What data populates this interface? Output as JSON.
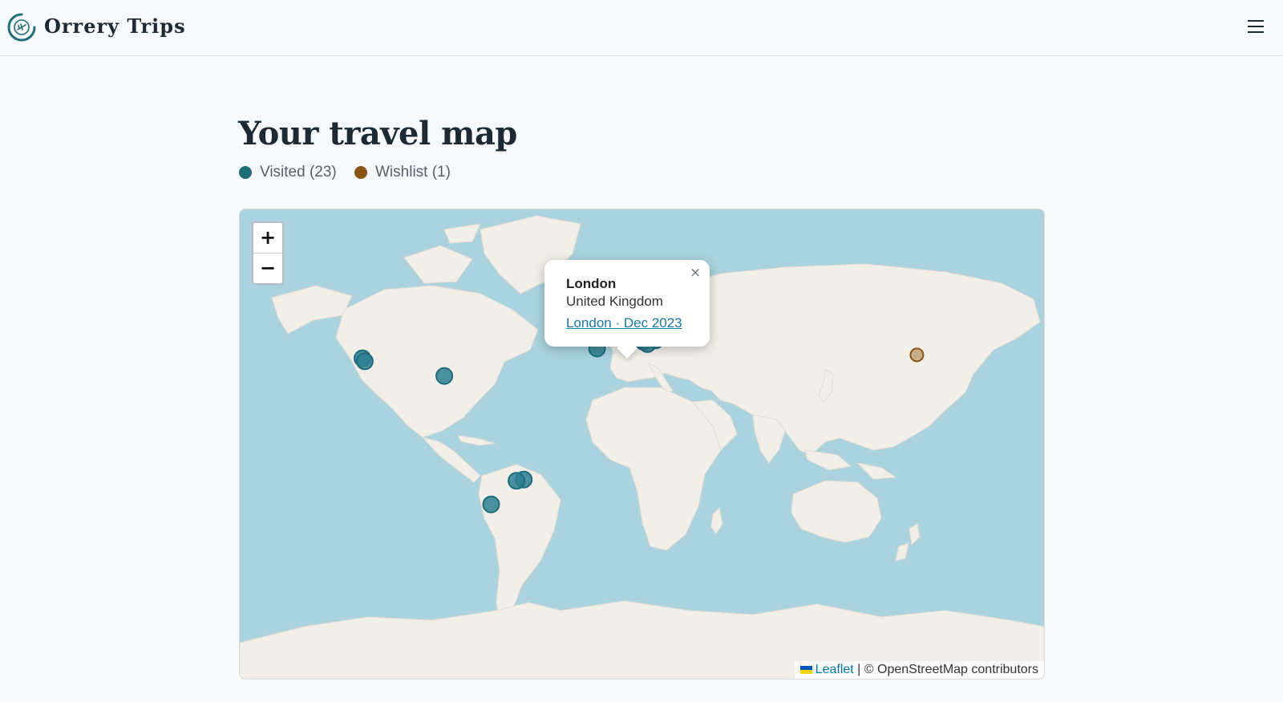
{
  "header": {
    "brand": "Orrery Trips",
    "logo_icon": "compass-plane-icon",
    "menu_icon": "hamburger-menu-icon",
    "accent_color": "#1e6e79"
  },
  "page": {
    "title": "Your travel map"
  },
  "legend": {
    "visited_label": "Visited (23)",
    "visited_color": "#1e6e79",
    "wishlist_label": "Wishlist (1)",
    "wishlist_color": "#8a5415"
  },
  "map": {
    "ocean_color": "#aad3df",
    "land_color": "#f2efe9",
    "marker_color": "#2d7f91",
    "zoom": {
      "in_label": "+",
      "out_label": "−"
    },
    "markers_visited": [
      {
        "lat": 34.1,
        "lon": -118.3
      },
      {
        "lat": 32.7,
        "lon": -117.2
      },
      {
        "lat": 25.8,
        "lon": -80.2
      },
      {
        "lat": 38.7,
        "lon": -9.1
      },
      {
        "lat": 53.3,
        "lon": -6.3
      },
      {
        "lat": 51.5,
        "lon": -0.1
      },
      {
        "lat": 59.3,
        "lon": 18.1
      },
      {
        "lat": 52.5,
        "lon": 13.4
      },
      {
        "lat": 50.1,
        "lon": 14.4
      },
      {
        "lat": 48.2,
        "lon": 16.4
      },
      {
        "lat": 47.5,
        "lon": 19.0
      },
      {
        "lat": 45.5,
        "lon": 12.3
      },
      {
        "lat": 43.8,
        "lon": 11.3
      },
      {
        "lat": 41.9,
        "lon": 12.5
      },
      {
        "lat": 45.8,
        "lon": 16.0
      },
      {
        "lat": 46.0,
        "lon": 14.5
      },
      {
        "lat": 42.6,
        "lon": 18.1
      },
      {
        "lat": 40.8,
        "lon": 14.3
      },
      {
        "lat": 44.8,
        "lon": 20.5
      },
      {
        "lat": 48.9,
        "lon": 2.3
      },
      {
        "lat": -22.9,
        "lon": -43.2
      },
      {
        "lat": -23.5,
        "lon": -46.6
      },
      {
        "lat": -34.6,
        "lon": -58.4
      }
    ],
    "markers_wishlist": [
      {
        "lat": 35.7,
        "lon": 139.7
      }
    ],
    "popup": {
      "title": "London",
      "country": "United Kingdom",
      "link": "London · Dec 2023",
      "close_glyph": "×"
    },
    "attribution": {
      "leaflet": "Leaflet",
      "separator": " | ",
      "osm": "© OpenStreetMap contributors"
    }
  }
}
